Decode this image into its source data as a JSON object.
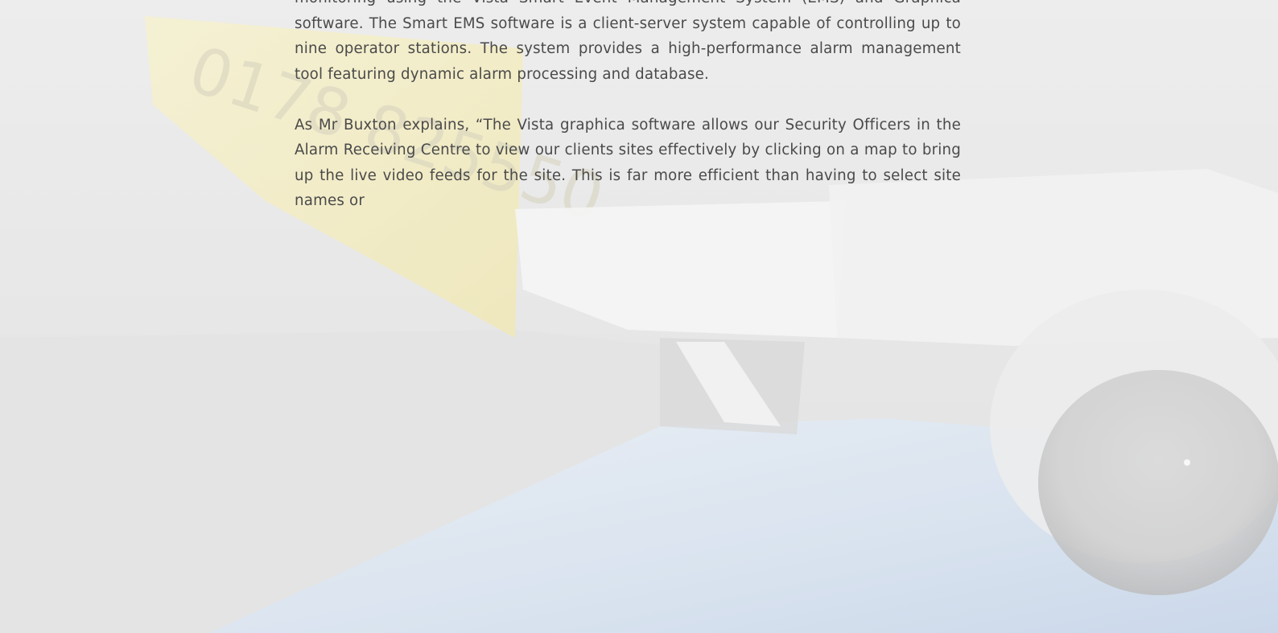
{
  "article": {
    "paragraph_1": "monitoring using the Vista Smart Event Management System (EMS) and Graphica software. The Smart EMS software is a client-server system capable of controlling up to nine operator stations. The system provides a high-performance alarm management tool featuring dynamic alarm processing and database.",
    "paragraph_2": "As Mr Buxton explains, “The Vista graphica software allows our Security Officers in the Alarm Receiving Centre to view our clients sites effectively by clicking on a map to bring up the live video feeds for the site. This is far more efficient than having to select site names or"
  },
  "background": {
    "sign_text": "0178 825550",
    "colors": {
      "sky": "#cdd9e8",
      "sign_yellow": "#f3ecc0",
      "wall": "#e3e3e3",
      "camera_dome": "#c9c9c9",
      "text": "#4a4a4a"
    }
  }
}
